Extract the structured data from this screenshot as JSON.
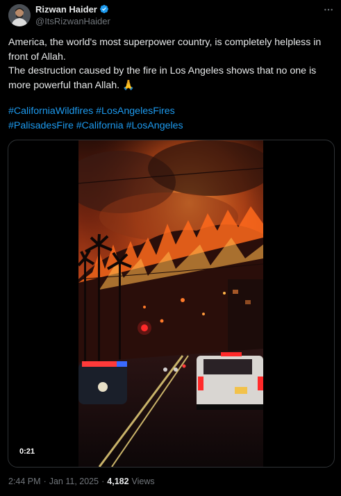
{
  "author": {
    "display_name": "Rizwan Haider",
    "handle": "@ItsRizwanHaider",
    "verified_icon": "verified-badge-icon"
  },
  "more_icon": "more-horizontal-icon",
  "tweet": {
    "text_lines": [
      "America, the world's most superpower country, is completely helpless in",
      "front of Allah.",
      "The destruction caused by the fire in Los Angeles shows that no one is",
      "more powerful than Allah. 🙏"
    ],
    "hashtags_line1": [
      "#CaliforniaWildfires",
      "#LosAngelesFires"
    ],
    "hashtags_line2": [
      "#PalisadesFire",
      "#California",
      "#LosAngeles"
    ]
  },
  "media": {
    "type": "video",
    "duration": "0:21"
  },
  "meta": {
    "time": "2:44 PM",
    "separator": "·",
    "date": "Jan 11, 2025",
    "views_count": "4,182",
    "views_label": "Views"
  },
  "colors": {
    "background": "#000000",
    "text": "#e7e9ea",
    "secondary_text": "#71767b",
    "link": "#1d9bf0",
    "verified": "#1d9bf0",
    "border": "#2f3336"
  }
}
